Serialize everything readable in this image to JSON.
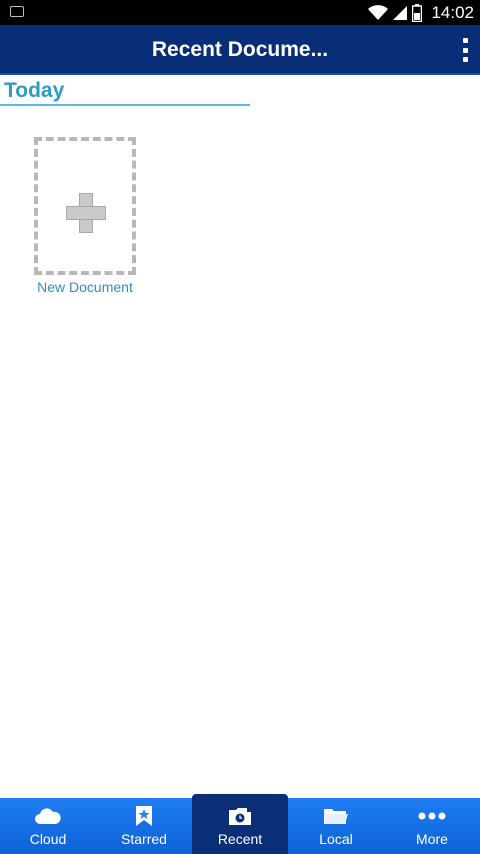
{
  "status_bar": {
    "time": "14:02"
  },
  "app_bar": {
    "title": "Recent Docume..."
  },
  "section": {
    "header": "Today"
  },
  "new_document": {
    "label": "New Document"
  },
  "bottom_nav": {
    "items": [
      {
        "label": "Cloud",
        "icon": "cloud-icon"
      },
      {
        "label": "Starred",
        "icon": "bookmark-star-icon"
      },
      {
        "label": "Recent",
        "icon": "recent-folder-icon",
        "active": true
      },
      {
        "label": "Local",
        "icon": "folder-icon"
      },
      {
        "label": "More",
        "icon": "more-dots-icon"
      }
    ]
  },
  "colors": {
    "app_bar": "#0a2d78",
    "accent": "#2e9bc6",
    "nav_bar": "#1f7ef2",
    "nav_active": "#0b2f76"
  }
}
